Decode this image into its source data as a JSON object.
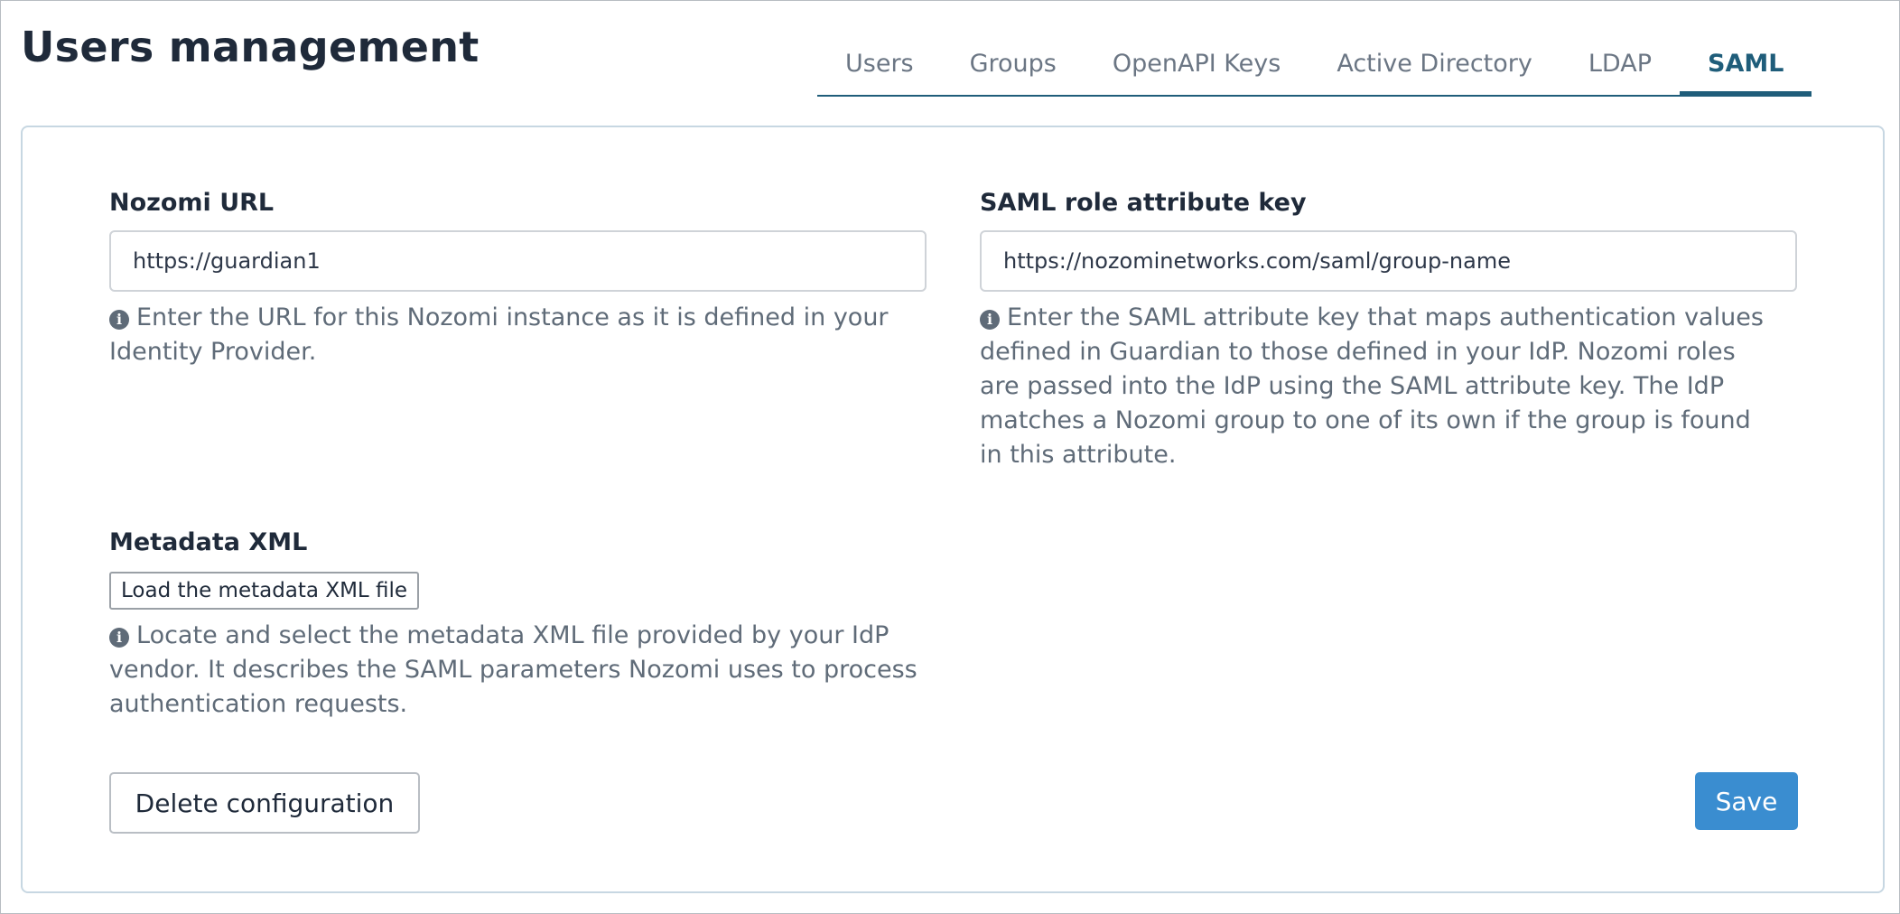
{
  "page": {
    "title": "Users management"
  },
  "tabs": [
    {
      "label": "Users"
    },
    {
      "label": "Groups"
    },
    {
      "label": "OpenAPI Keys"
    },
    {
      "label": "Active Directory"
    },
    {
      "label": "LDAP"
    },
    {
      "label": "SAML",
      "active": true
    }
  ],
  "form": {
    "nozomi_url": {
      "label": "Nozomi URL",
      "value": "https://guardian1",
      "help": "Enter the URL for this Nozomi instance as it is defined in your Identity Provider."
    },
    "saml_role_key": {
      "label": "SAML role attribute key",
      "value": "https://nozominetworks.com/saml/group-name",
      "help": "Enter the SAML attribute key that maps authentication values defined in Guardian to those defined in your IdP. Nozomi roles are passed into the IdP using the SAML attribute key. The IdP matches a Nozomi group to one of its own if the group is found in this attribute."
    },
    "metadata_xml": {
      "label": "Metadata XML",
      "button_label": "Load the metadata XML file",
      "help": "Locate and select the metadata XML file provided by your IdP vendor. It describes the SAML parameters Nozomi uses to process authentication requests."
    }
  },
  "actions": {
    "delete_label": "Delete configuration",
    "save_label": "Save"
  },
  "colors": {
    "accent": "#1f5d7a",
    "save_button": "#3a8dd0",
    "help_text": "#5f6b78"
  },
  "icons": {
    "info": "info-circle-icon"
  }
}
